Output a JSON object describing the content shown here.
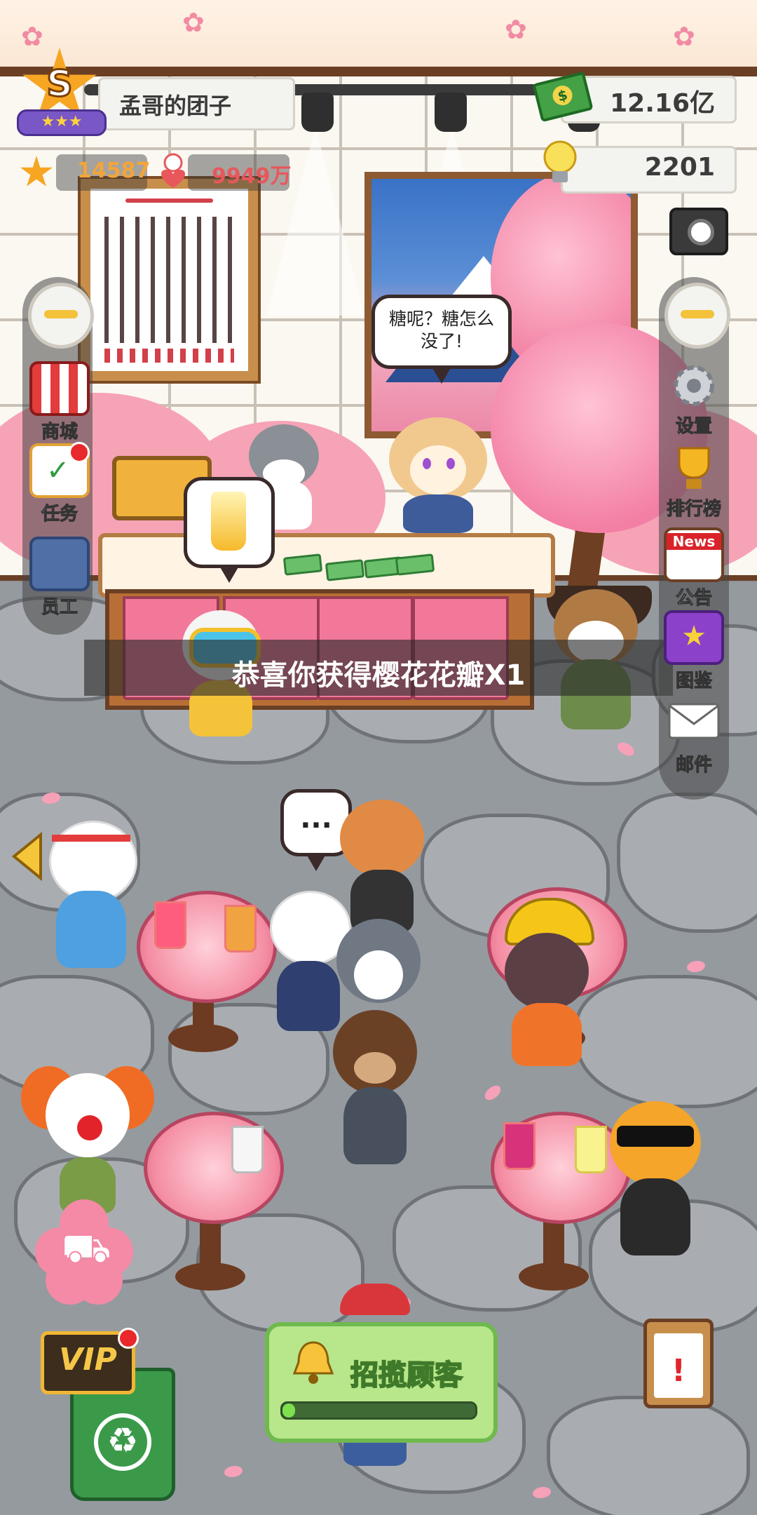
{
  "shop": {
    "name": "孟哥的团子",
    "rank_letter": "S",
    "rank_stars": "★★★"
  },
  "stats": {
    "stars": "14587",
    "fans": "9949万"
  },
  "currency": {
    "cash": "12.16亿",
    "ideas": "2201"
  },
  "colors": {
    "accent_yellow": "#f4c23a",
    "fans_red": "#e8575c",
    "stars_orange": "#f6a623",
    "recruit_green": "#b8e68a"
  },
  "left_menu": [
    {
      "label": "商城",
      "icon": "shop-stall-icon"
    },
    {
      "label": "任务",
      "icon": "task-calendar-icon",
      "has_badge": true
    },
    {
      "label": "员工",
      "icon": "staff-vest-icon"
    }
  ],
  "right_menu": [
    {
      "label": "设置",
      "icon": "gear-icon"
    },
    {
      "label": "排行榜",
      "icon": "trophy-icon"
    },
    {
      "label": "公告",
      "icon": "news-icon",
      "icon_text": "News"
    },
    {
      "label": "图鉴",
      "icon": "album-icon"
    },
    {
      "label": "邮件",
      "icon": "mail-icon"
    }
  ],
  "speech": {
    "chef": "糖呢？糖怎么没了!",
    "customer": "..."
  },
  "toast": "恭喜你获得樱花花瓣X1",
  "bottom": {
    "vip_label": "VIP",
    "recruit_label": "招揽顾客",
    "recruit_progress": 0.05
  },
  "icons": {
    "camera": "camera-icon",
    "cash": "cash-icon",
    "idea": "lightbulb-icon",
    "cart": "cart-icon",
    "recycle": "recycle-icon",
    "clipboard": "clipboard-alert-icon",
    "left_arrow": "arrow-left-icon",
    "bell": "bell-icon"
  }
}
